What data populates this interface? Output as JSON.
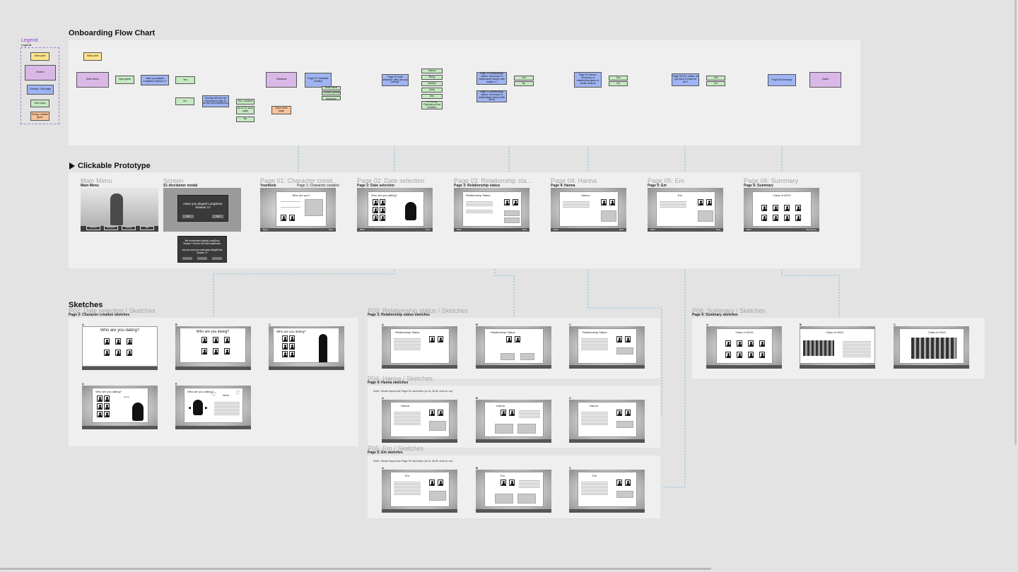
{
  "legend": {
    "title": "Legend",
    "subtitle": "Legend",
    "items": [
      "Start point",
      "Screen",
      "Overlay / Sub page",
      "User input",
      "Exit/go outside game"
    ]
  },
  "sections": {
    "flowchart": "Onboarding Flow Chart",
    "prototype": "Clickable Prototype",
    "sketches": "Sketches"
  },
  "flow": {
    "start": "Start point",
    "main_menu": "Main Menu",
    "new_game": "New game",
    "played_q": "Have you played LongStory Season 1?",
    "yes": "Yes",
    "no": "No",
    "overlay_note": "Overlay tell user we recommend play S1 for the best experience",
    "yes_continue": "Yes, continue",
    "go_to_s1": "Go to S1 store page",
    "open_store": "Open store page",
    "yearbook": "Yearbook",
    "page01": "Page 01 Character creation",
    "page01_note": "First yearbook tutorial",
    "write_name": "Write name",
    "choose_portrait": "Choose portrait",
    "choose_pronouns": "Choose pronouns",
    "page02": "Page 02 Date selection: Who are you dating?",
    "options": [
      "Hanna",
      "Micky",
      "Martina",
      "Zoey",
      "Eric",
      "Not dating. Figuring out my situation"
    ],
    "page03a": "Page 03 Relationship status: Summary of relationship history with chosen LI",
    "page03b": "Page 03 Relationship status: Summary of relationship history with friend",
    "page04": "Page 04 Hanna: Summary of relationship game to create choices",
    "page05": "Page 05 Em: Lately, do you have a crush on Em?",
    "page06": "Page 06 Summary",
    "game": "Game"
  },
  "prototype": {
    "frames": [
      {
        "ghost": "Main Menu",
        "label": "Main Menu"
      },
      {
        "ghost": "Screen",
        "label": "S1 disclaimer modal"
      },
      {
        "ghost": "Page 01: Character creati...",
        "label": "Yearbook",
        "label2": "Page 1: Character creation"
      },
      {
        "ghost": "Page 02: Date selection",
        "label": "Page 2: Date selection"
      },
      {
        "ghost": "Page 03: Relationship sta...",
        "label": "Page 3: Relationship status"
      },
      {
        "ghost": "Page 04: Hanna",
        "label": "Page 4: Hanna"
      },
      {
        "ghost": "Page 05: Em",
        "label": "Page 5: Em"
      },
      {
        "ghost": "Page 06: Summary",
        "label": "Page 6: Summary"
      }
    ],
    "menu_buttons": [
      "Continue",
      "New game",
      "Settings",
      "Quit"
    ],
    "modal_text": "Have you played LongStory Season 1?",
    "modal_no": "No",
    "modal_yes": "Yes",
    "modal2_text": "We recommend playing LongStory Season 1 first for the best experience.",
    "modal2_q": "Are you sure you want jump straight into Season 2?",
    "card_titles": [
      "Who are you?",
      "Who are you dating?",
      "Relationship Status",
      "Hanna",
      "Em",
      "Class of 20XX"
    ],
    "back": "Back",
    "next": "Next",
    "start_game": "Start game"
  },
  "sketches": {
    "p02": {
      "ghost": "P02: Date selection / Sketches",
      "label": "Page 2: Character creation sketches",
      "title": "Who are you dating?",
      "name": "Name"
    },
    "p03": {
      "ghost": "P03: Relationship status / Sketches",
      "label": "Page 3: Relationship status sketches",
      "title": "Relationship Status"
    },
    "p04": {
      "ghost": "P04: Hanna / Sketches",
      "label": "Page 4: Hanna sketches",
      "note": "Note: Same layout as Page 02 sketches (A=A, B=B, and so on)",
      "title": "Hanna"
    },
    "p05": {
      "ghost": "P05: Em / Sketches",
      "label": "Page 5: Em sketches",
      "note": "Note: Same layout as Page 02 sketches (A=A, B=B, and so on)",
      "title": "Em"
    },
    "p06": {
      "ghost": "P06: Summary / Sketches",
      "label": "Page 6: Summary sketches",
      "title": "Class of 20XX"
    },
    "letters": [
      "A",
      "B",
      "C",
      "D",
      "E"
    ]
  },
  "colors": {
    "start": "#fbe38c",
    "screen": "#d9b8e8",
    "overlay": "#9fb4f2",
    "input": "#c6e8c1",
    "exit": "#f8c39a",
    "prototype_link": "#5ee05e",
    "annotation": "#2aa0d8"
  }
}
